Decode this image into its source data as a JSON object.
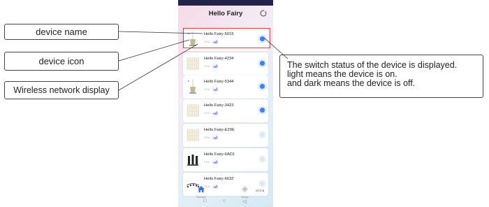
{
  "callouts": {
    "device_name": "device name",
    "device_icon": "device icon",
    "wireless": "Wireless network display",
    "switch_lines": [
      "The switch status of the device is displayed.",
      "light means the device is on.",
      "and dark means the device is off."
    ]
  },
  "app": {
    "title": "Hello Fairy",
    "devices": [
      {
        "name": "Hello Fairy-5015",
        "rssi": "RSSI: -46",
        "icon": "light-string-icon",
        "on": true
      },
      {
        "name": "Hello Fairy-4234",
        "rssi": "RSSI: -50",
        "icon": "curtain-lights-icon",
        "on": true
      },
      {
        "name": "Hello Fairy-5344",
        "rssi": "RSSI: -57",
        "icon": "light-string-icon",
        "on": true
      },
      {
        "name": "Hello Fairy-3423",
        "rssi": "RSSI: -60",
        "icon": "curtain-lights-icon",
        "on": true
      },
      {
        "name": "Hello Fairy-E20E",
        "rssi": "RSSI: -61",
        "icon": "curtain-lights-icon",
        "on": false
      },
      {
        "name": "Hello Fairy-6AD1",
        "rssi": "RSSI: -66",
        "icon": "bulbs-icon",
        "on": false
      },
      {
        "name": "Hello Fairy-6632",
        "rssi": "RSSI: -70",
        "icon": "string-lights-icon",
        "on": false
      }
    ],
    "nav": {
      "devices": "Devices",
      "group": "Group",
      "version": "v0.0.5"
    }
  },
  "colors": {
    "accent": "#3b82f6",
    "highlight": "#e53935"
  }
}
